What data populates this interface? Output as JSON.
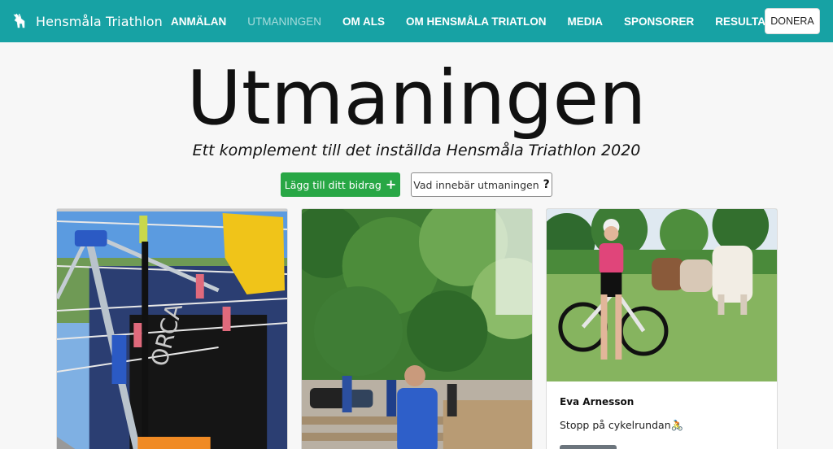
{
  "brand": {
    "name": "Hensmåla Triathlon",
    "logo_icon": "goat-logo-icon"
  },
  "nav": {
    "items": [
      {
        "label": "ANMÄLAN",
        "active": false
      },
      {
        "label": "UTMANINGEN",
        "active": true
      },
      {
        "label": "OM ALS",
        "active": false
      },
      {
        "label": "OM HENSMÅLA TRIATLON",
        "active": false
      },
      {
        "label": "MEDIA",
        "active": false
      },
      {
        "label": "SPONSORER",
        "active": false
      },
      {
        "label": "RESULTAT",
        "active": false,
        "dropdown": true
      }
    ],
    "donate_label": "DONERA"
  },
  "hero": {
    "title": "Utmaningen",
    "subtitle": "Ett komplement till det inställda Hensmåla Triathlon 2020",
    "add_button_label": "Lägg till ditt bidrag",
    "add_button_icon": "plus-icon",
    "info_button_label": "Vad innebär utmaningen",
    "info_button_icon": "question-icon"
  },
  "cards": [
    {
      "image": "laundry-drying-rack-photo",
      "author": "",
      "text": ""
    },
    {
      "image": "cyclist-in-forest-photo",
      "author": "",
      "text": ""
    },
    {
      "image": "woman-with-bike-and-cows-photo",
      "author": "Eva Arnesson",
      "text": "Stopp på cykelrundan🚴"
    }
  ],
  "colors": {
    "navbar": "#17a2a4",
    "add_button": "#28a745",
    "page_bg": "#f7f7f7"
  }
}
